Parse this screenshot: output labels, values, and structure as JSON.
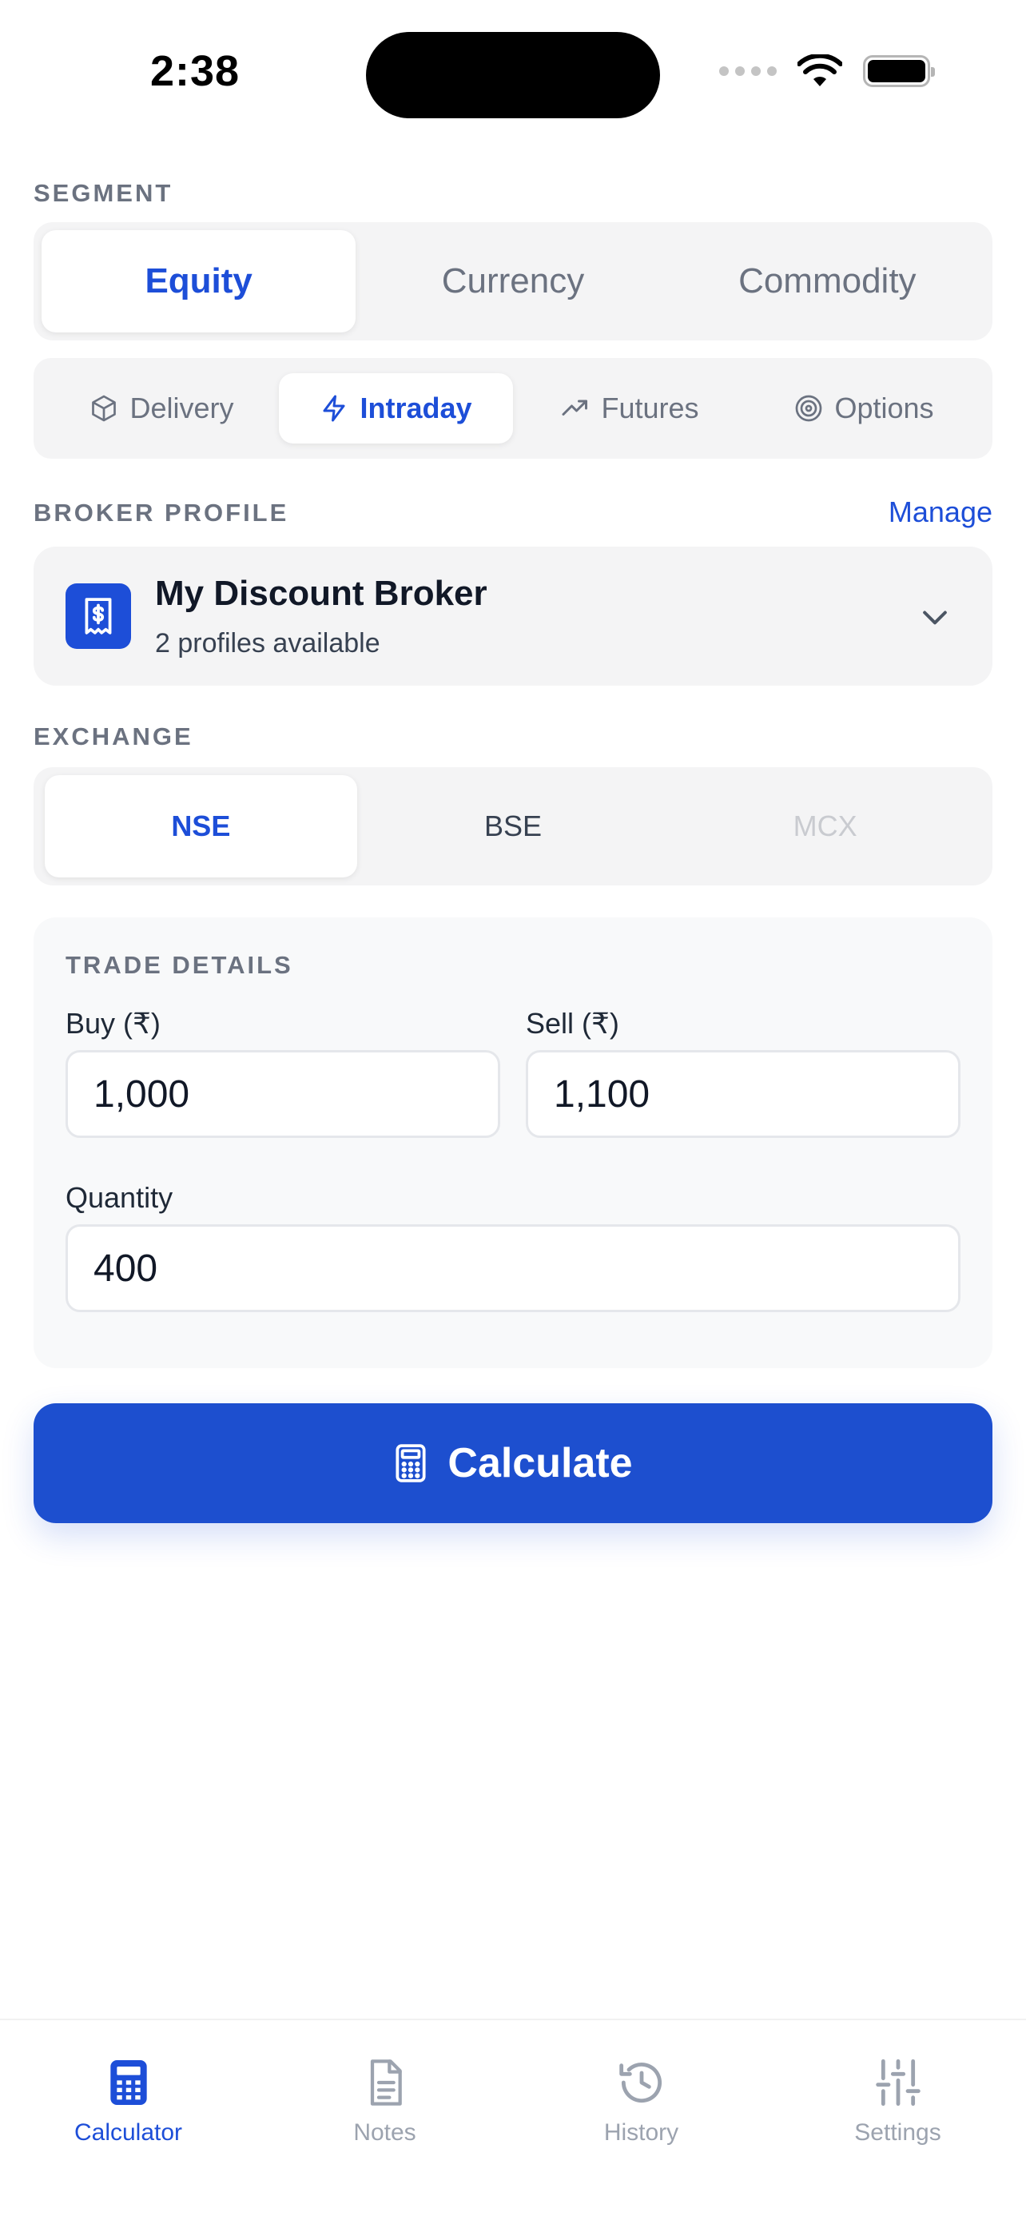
{
  "status_bar": {
    "time": "2:38"
  },
  "segment": {
    "label": "SEGMENT",
    "options": [
      "Equity",
      "Currency",
      "Commodity"
    ],
    "selected": "Equity"
  },
  "trade_type": {
    "options": [
      {
        "label": "Delivery",
        "icon": "box-icon"
      },
      {
        "label": "Intraday",
        "icon": "lightning-icon"
      },
      {
        "label": "Futures",
        "icon": "trending-up-icon"
      },
      {
        "label": "Options",
        "icon": "target-icon"
      }
    ],
    "selected": "Intraday"
  },
  "broker": {
    "label": "BROKER PROFILE",
    "manage_label": "Manage",
    "name": "My Discount Broker",
    "subtitle": "2 profiles available",
    "icon": "receipt-dollar-icon"
  },
  "exchange": {
    "label": "EXCHANGE",
    "options": [
      "NSE",
      "BSE",
      "MCX"
    ],
    "selected": "NSE",
    "disabled": "MCX"
  },
  "trade_details": {
    "title": "TRADE DETAILS",
    "buy_label": "Buy (₹)",
    "buy_value": "1,000",
    "sell_label": "Sell (₹)",
    "sell_value": "1,100",
    "quantity_label": "Quantity",
    "quantity_value": "400"
  },
  "calculate_button": {
    "label": "Calculate",
    "icon": "calculator-icon"
  },
  "tab_bar": {
    "tabs": [
      {
        "label": "Calculator",
        "icon": "calculator-icon"
      },
      {
        "label": "Notes",
        "icon": "document-icon"
      },
      {
        "label": "History",
        "icon": "history-icon"
      },
      {
        "label": "Settings",
        "icon": "sliders-icon"
      }
    ],
    "selected": "Calculator"
  },
  "colors": {
    "accent": "#1d4ed8",
    "button": "#1d4fcf",
    "muted_text": "#6b7280",
    "surface": "#f4f4f5"
  }
}
